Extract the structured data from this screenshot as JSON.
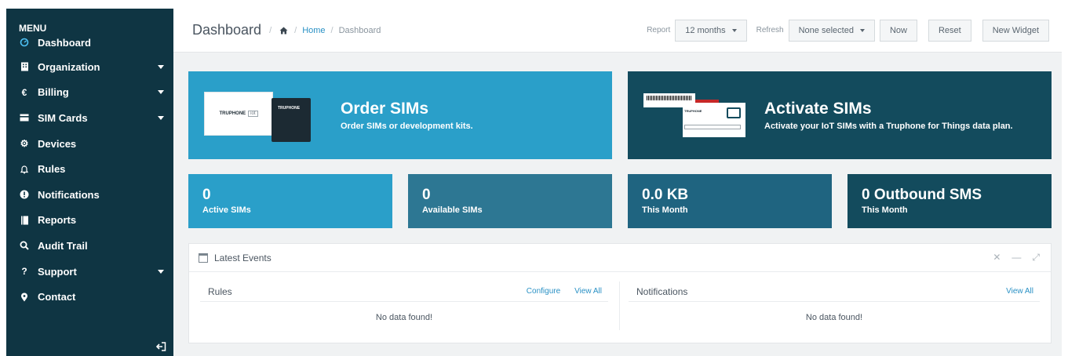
{
  "sidebar": {
    "menu_title": "MENU",
    "items": [
      {
        "label": "Dashboard",
        "icon": "dashboard-icon"
      },
      {
        "label": "Organization",
        "icon": "building-icon"
      },
      {
        "label": "Billing",
        "icon": "euro-icon"
      },
      {
        "label": "SIM Cards",
        "icon": "sim-card-icon"
      },
      {
        "label": "Devices",
        "icon": "cogs-icon"
      },
      {
        "label": "Rules",
        "icon": "bell-icon"
      },
      {
        "label": "Notifications",
        "icon": "alert-icon"
      },
      {
        "label": "Reports",
        "icon": "report-icon"
      },
      {
        "label": "Audit Trail",
        "icon": "search-icon"
      },
      {
        "label": "Support",
        "icon": "question-icon"
      },
      {
        "label": "Contact",
        "icon": "map-marker-icon"
      }
    ]
  },
  "header": {
    "title": "Dashboard",
    "breadcrumb_home": "Home",
    "breadcrumb_current": "Dashboard",
    "report_label": "Report",
    "report_value": "12 months",
    "refresh_label": "Refresh",
    "refresh_value": "None selected",
    "now_label": "Now",
    "reset_label": "Reset",
    "new_widget_label": "New Widget"
  },
  "banners": {
    "order": {
      "title": "Order SIMs",
      "subtitle": "Order SIMs or development kits.",
      "card_brand": "TRUPHONE",
      "card_tag": "iot"
    },
    "activate": {
      "title": "Activate SIMs",
      "subtitle": "Activate your IoT SIMs with a Truphone for Things data plan.",
      "card_brand": "TRUPHONE"
    }
  },
  "stats": [
    {
      "value": "0",
      "label": "Active SIMs"
    },
    {
      "value": "0",
      "label": "Available SIMs"
    },
    {
      "value": "0.0 KB",
      "label": "This Month"
    },
    {
      "value": "0 Outbound SMS",
      "label": "This Month"
    }
  ],
  "events": {
    "title": "Latest Events",
    "rules_title": "Rules",
    "configure_label": "Configure",
    "view_all_label": "View All",
    "notifications_title": "Notifications",
    "empty_text": "No data found!"
  },
  "colors": {
    "sidebar_bg": "#0f3543",
    "accent_blue": "#2a9fc9",
    "dark_teal": "#134b5d",
    "link": "#2a91c5"
  }
}
